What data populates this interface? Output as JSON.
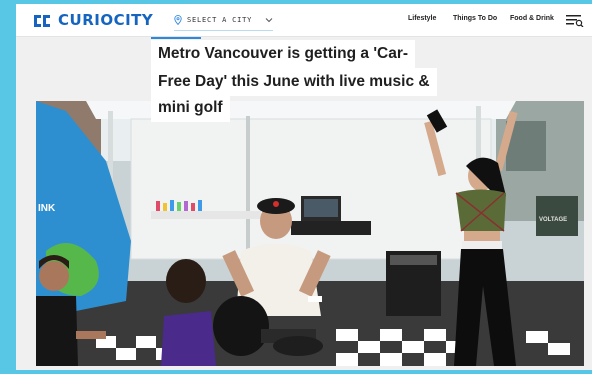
{
  "header": {
    "logo_text": "CURIOCITY",
    "city_select_label": "SELECT A CITY",
    "nav": [
      "Lifestyle",
      "Things To Do",
      "Food & Drink"
    ]
  },
  "article": {
    "headline_lines": [
      "Metro Vancouver is getting a 'Car-",
      "Free Day' this June with live music &",
      "mini golf"
    ]
  },
  "photo": {
    "sign_text": [
      "INK",
      "VOLTAGE"
    ]
  },
  "colors": {
    "brand_blue": "#1565c0",
    "page_border": "#58c7e6",
    "accent": "#2b87e0"
  }
}
